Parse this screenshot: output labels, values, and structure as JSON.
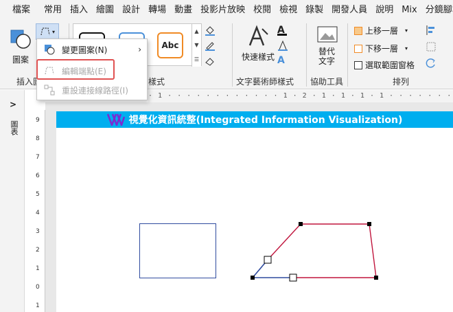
{
  "menu_tabs": [
    "檔案",
    "常用",
    "插入",
    "繪圖",
    "設計",
    "轉場",
    "動畫",
    "投影片放映",
    "校閱",
    "檢視",
    "錄製",
    "開發人員",
    "說明",
    "Mix",
    "分鏡腳本"
  ],
  "ribbon": {
    "insert_group": {
      "label": "插入圖",
      "shapes_label": "圖案"
    },
    "styles_group_label": "樣式",
    "style_sample_text": "Abc",
    "wordart": {
      "button_label": "快速樣式",
      "group_label": "文字藝術師樣式"
    },
    "accessibility": {
      "button_label": "替代文字",
      "group_label": "協助工具"
    },
    "arrange": {
      "bring_forward": "上移一層",
      "send_backward": "下移一層",
      "selection_pane": "選取範圍窗格",
      "group_label": "排列"
    }
  },
  "dropdown": {
    "change_shape": "變更圖案(N)",
    "edit_points": "編輯端點(E)",
    "reroute": "重設連接線路徑(I)"
  },
  "left_pane": {
    "toggle": ">",
    "label": "圖表"
  },
  "hruler_text": "· 1 · · · · · · · · · · · · 1 · 2 · 1 · 1 · 1 · 1 · · · · · · · · · · · · · · ·",
  "vruler_numbers": [
    "9",
    "8",
    "7",
    "6",
    "5",
    "4",
    "3",
    "2",
    "1",
    "0",
    "1"
  ],
  "slide": {
    "banner_title": "視覺化資訊統整(Integrated Information Visualization)"
  },
  "colors": {
    "banner": "#00aeef",
    "highlight": "#e05151",
    "shape_blue": "#2e4a9e",
    "shape_red": "#c0143c",
    "logo_purple": "#7a2bd1"
  }
}
